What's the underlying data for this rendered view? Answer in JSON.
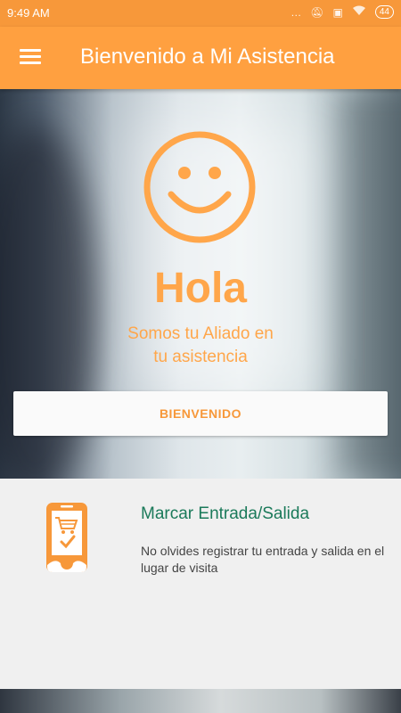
{
  "status_bar": {
    "time": "9:49 AM",
    "battery": "44",
    "icons": [
      "dots-icon",
      "mute-icon",
      "sim-icon",
      "wifi-icon",
      "battery-icon"
    ]
  },
  "app_bar": {
    "title": "Bienvenido a Mi Asistencia",
    "menu_icon": "hamburger-menu-icon"
  },
  "hero": {
    "greeting": "Hola",
    "subtitle_line1": "Somos tu Aliado en",
    "subtitle_line2": "tu asistencia",
    "button_label": "BIENVENIDO",
    "icon": "smiley-icon"
  },
  "card": {
    "icon": "phone-cart-icon",
    "title": "Marcar Entrada/Salida",
    "text": "No olvides registrar tu entrada y salida en el lugar de visita"
  },
  "colors": {
    "primary": "#ffa040",
    "status_bar": "#f7983a",
    "accent_text": "#ffa64a",
    "card_title": "#1b7a5a"
  }
}
